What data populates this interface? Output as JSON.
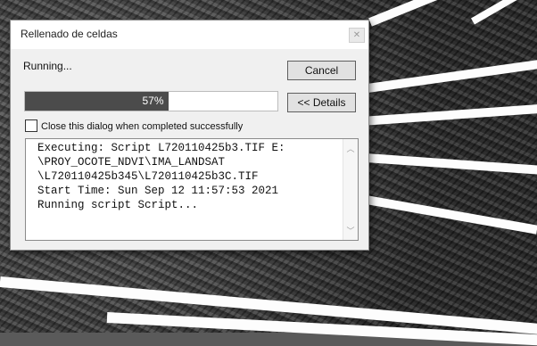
{
  "dialog": {
    "title": "Rellenado de celdas",
    "status": "Running...",
    "cancel_label": "Cancel",
    "details_label": "<< Details",
    "progress_percent": 57,
    "progress_label": "57%",
    "checkbox_label": "Close this dialog when completed successfully",
    "checkbox_checked": false,
    "log_lines": [
      "Executing: Script L720110425b3.TIF E:",
      "\\PROY_OCOTE_NDVI\\IMA_LANDSAT",
      "\\L720110425b345\\L720110425b3C.TIF",
      "Start Time: Sun Sep 12 11:57:53 2021",
      "Running script Script..."
    ]
  },
  "icons": {
    "close": "close-icon",
    "scroll_up": "chevron-up-icon",
    "scroll_down": "chevron-down-icon"
  },
  "colors": {
    "progress_fill": "#4b4b4b",
    "dialog_bg": "#f0f0f0"
  }
}
